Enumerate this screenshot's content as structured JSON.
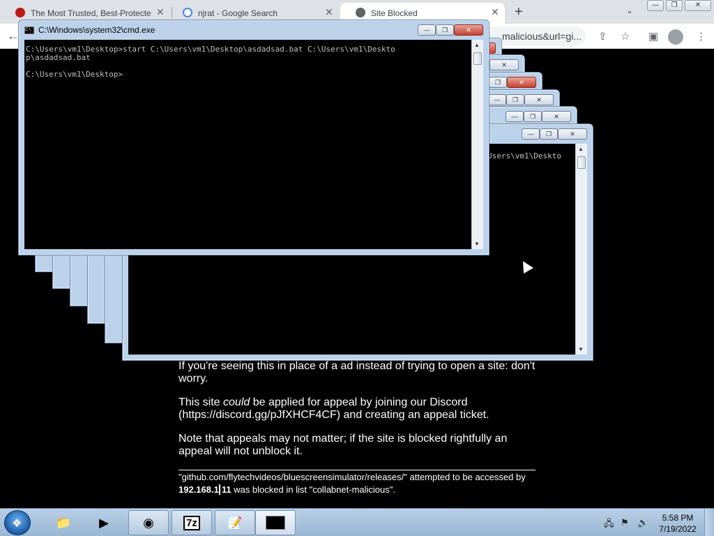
{
  "browser": {
    "tabs": [
      {
        "title": "The Most Trusted, Best-Protected",
        "icon": "mcafee-icon"
      },
      {
        "title": "njrat - Google Search",
        "icon": "google-icon"
      },
      {
        "title": "Site Blocked",
        "icon": "globe-icon"
      }
    ],
    "url_tail": "malicious&url=gi..."
  },
  "page": {
    "para1": "If you're seeing this in place of a ad instead of trying to open a site: don't worry.",
    "para2_pre": "This site ",
    "para2_em": "could",
    "para2_post": " be applied for appeal by joining our Discord (https://discord.gg/pJfXHCF4CF) and creating an appeal ticket.",
    "para3": "Note that appeals may not matter; if the site is blocked rightfully an appeal will not unblock it.",
    "footer_pre": "\"github.com/flytechvideos/bluescreensimulator/releases/\" attempted to be accessed by",
    "footer_ip": "192.168.1",
    "footer_ip2": "11",
    "footer_post": " was blocked in list \"collabnet-malicious\"."
  },
  "cmd": {
    "title": "C:\\Windows\\system32\\cmd.exe",
    "front_text": "C:\\Users\\vm1\\Desktop>start C:\\Users\\vm1\\Desktop\\asdadsad.bat C:\\Users\\vm1\\Deskto\np\\asdadsad.bat\n\nC:\\Users\\vm1\\Desktop>",
    "back_text": "Users\\vm1\\Deskto"
  },
  "taskbar": {
    "time": "5:58 PM",
    "date": "7/19/2022",
    "apps": [
      "explorer-icon",
      "media-player-icon",
      "chrome-icon",
      "7zip-icon",
      "notepad-icon",
      "cmd-icon"
    ],
    "sevenzip_label": "7z"
  }
}
